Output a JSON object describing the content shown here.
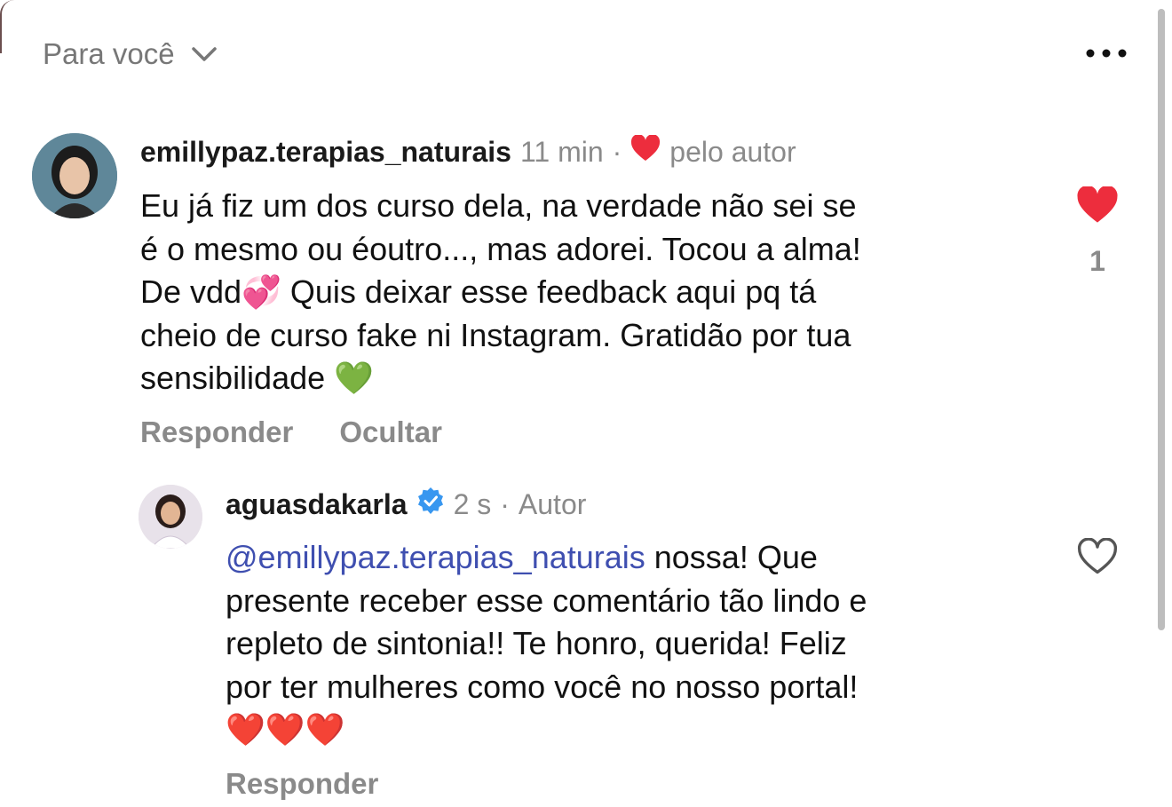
{
  "header": {
    "title": "Para você",
    "chevron_icon": "chevron-down-icon",
    "more_icon": "more-horizontal-icon"
  },
  "comments": [
    {
      "username": "emillypaz.terapias_naturais",
      "time": "11 min",
      "separator": "·",
      "liked_by_author_label": "pelo autor",
      "lines": [
        "Eu já fiz um dos curso dela, na verdade não sei se",
        "é o mesmo ou éoutro..., mas adorei. Tocou a alma!",
        "De vdd💞   Quis deixar esse feedback aqui pq tá",
        "cheio de curso fake ni Instagram. Gratidão por tua",
        "sensibilidade 💚"
      ],
      "like_count": "1",
      "like_state": "liked",
      "reply_label": "Responder",
      "hide_label": "Ocultar"
    },
    {
      "username": "aguasdakarla",
      "verified": true,
      "time": "2 s",
      "separator": "·",
      "author_label": "Autor",
      "mention": "@emillypaz.terapias_naturais",
      "first_line_rest": " nossa! Que",
      "lines": [
        "presente receber esse comentário tão lindo e",
        "repleto de sintonia!! Te honro, querida! Feliz",
        "por ter mulheres como você no nosso portal!",
        "❤️❤️❤️"
      ],
      "like_state": "not-liked",
      "reply_label": "Responder"
    }
  ],
  "colors": {
    "heart_red": "#ed2d3d",
    "muted_text": "#8a8a8a",
    "mention_blue": "#3f4fb0",
    "verified_blue": "#3897f0"
  }
}
